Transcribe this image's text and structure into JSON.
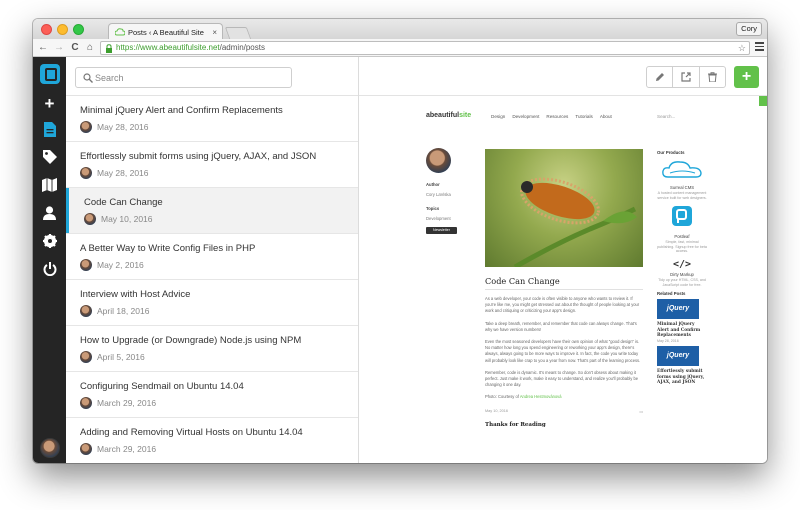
{
  "browser": {
    "tab_title": "Posts ‹ A Beautiful Site",
    "tab_close": "×",
    "profile": "Cory",
    "url_host": "https://www.abeautifulsite.net",
    "url_path": "/admin/posts",
    "back": "←",
    "forward": "→",
    "reload": "C",
    "home": "⌂",
    "star": "☆"
  },
  "rail": {
    "new_icon": "+",
    "items": [
      "plus-icon",
      "document-icon",
      "tag-icon",
      "map-icon",
      "user-icon",
      "gear-icon",
      "power-icon"
    ]
  },
  "search": {
    "placeholder": "Search",
    "value": ""
  },
  "posts": [
    {
      "title": "Minimal jQuery Alert and Confirm Replacements",
      "date": "May 28, 2016"
    },
    {
      "title": "Effortlessly submit forms using jQuery, AJAX, and JSON",
      "date": "May 28, 2016"
    },
    {
      "title": "Code Can Change",
      "date": "May 10, 2016"
    },
    {
      "title": "A Better Way to Write Config Files in PHP",
      "date": "May 2, 2016"
    },
    {
      "title": "Interview with Host Advice",
      "date": "April 18, 2016"
    },
    {
      "title": "How to Upgrade (or Downgrade) Node.js using NPM",
      "date": "April 5, 2016"
    },
    {
      "title": "Configuring Sendmail on Ubuntu 14.04",
      "date": "March 29, 2016"
    },
    {
      "title": "Adding and Removing Virtual Hosts on Ubuntu 14.04",
      "date": "March 29, 2016"
    }
  ],
  "active_post_index": 2,
  "editor": {
    "add_label": "+"
  },
  "preview": {
    "logo_main": "abeautiful",
    "logo_accent": "site",
    "nav": [
      "Design",
      "Development",
      "Resources",
      "Tutorials",
      "About"
    ],
    "search_placeholder": "Search...",
    "author_label": "Author",
    "author_name": "Cory LaViska",
    "topics_label": "Topics",
    "topic": "Development",
    "newsletter": "Newsletter",
    "article_title": "Code Can Change",
    "paragraphs": [
      "As a web developer, your code is often visible to anyone who wants to review it. If you're like me, you might get stressed out about the thought of people looking at your work and critiquing or criticizing your app's design.",
      "Take a deep breath, remember, and remember that code can always change. That's why we have version numbers!",
      "Even the most seasoned developers have their own opinion of what \"good design\" is. No matter how long you spend engineering or reworking your app's design, there's always, always going to be more ways to improve it. In fact, the code you write today will probably look like crap to you a year from now. That's part of the learning process.",
      "Remember, code is dynamic. It's meant to change. So don't obsess about making it perfect. Just make it work, make it easy to understand, and realize you'll probably be changing it one day."
    ],
    "credit_prefix": "Photo: Courtesy of ",
    "credit_name": "Andrea Hestmovánová",
    "article_date": "May 10, 2016",
    "thanks": "Thanks for Reading",
    "products_head": "Our Products",
    "products": [
      {
        "name": "Surreal CMS",
        "desc": "A hosted content management service built for web designers."
      },
      {
        "name": "Postleaf",
        "desc": "Simple, fast, minimal publishing. Signup free for beta access."
      },
      {
        "name": "Dirty Markup",
        "desc": "Tidy up your HTML, CSS, and JavaScript code for free."
      }
    ],
    "related_head": "Related Posts",
    "related": [
      {
        "title": "Minimal jQuery Alert and Confirm Replacements",
        "date": "May 28, 2016"
      },
      {
        "title": "Effortlessly submit forms using jQuery, AJAX, and JSON",
        "date": ""
      }
    ],
    "jquery_label": "jQuery"
  },
  "colors": {
    "accent": "#62c14a",
    "active_marker": "#1fa6d9",
    "rail": "#252525"
  }
}
